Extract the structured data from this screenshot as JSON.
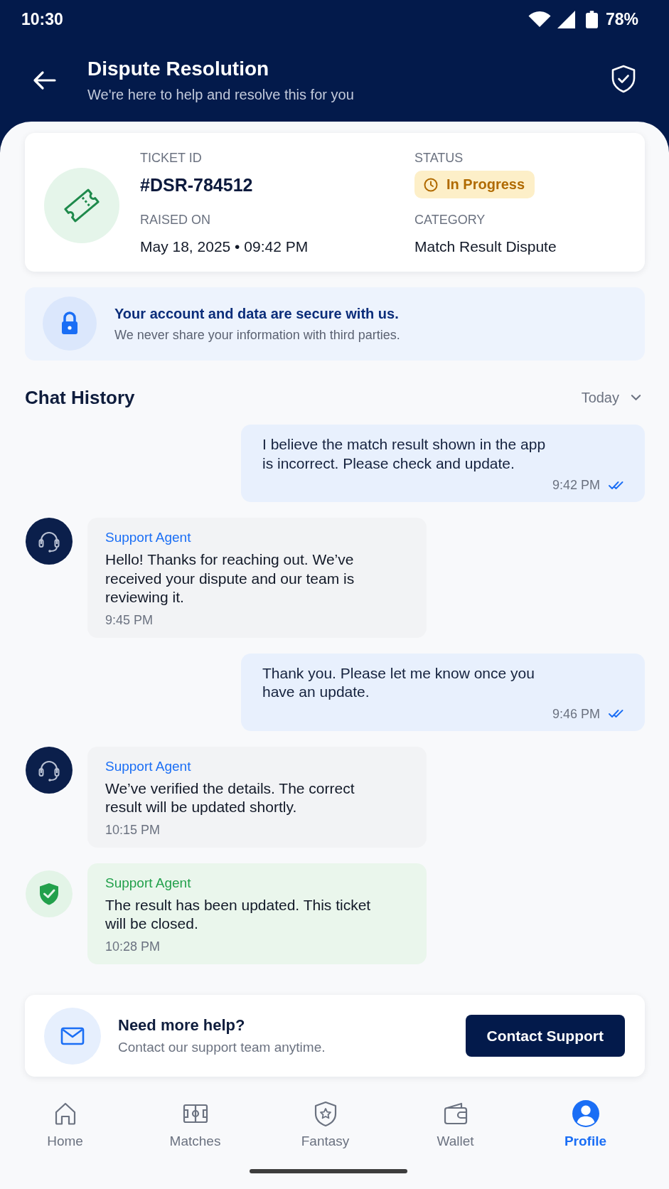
{
  "status_bar": {
    "time": "10:30",
    "battery": "78%"
  },
  "header": {
    "title": "Dispute Resolution",
    "subtitle": "We're here to help and resolve this for you"
  },
  "ticket": {
    "fields": [
      {
        "kind": "id",
        "label": "TICKET ID",
        "value": "#DSR-784512"
      },
      {
        "kind": "status",
        "label": "STATUS",
        "value": "In Progress"
      },
      {
        "kind": "text",
        "label": "RAISED ON",
        "value": "May 18, 2025 • 09:42 PM"
      },
      {
        "kind": "text",
        "label": "CATEGORY",
        "value": "Match Result Dispute"
      }
    ]
  },
  "security_notice": {
    "title": "Your account and data are secure with us.",
    "text": "We never share your information with third parties."
  },
  "chat": {
    "title": "Chat History",
    "filter": "Today",
    "messages": [
      {
        "kind": "user",
        "text": "I believe the match result shown in the app is incorrect. Please check and update.",
        "time": "9:42 PM",
        "read": true
      },
      {
        "kind": "agent",
        "sender": "Support Agent",
        "text": "Hello! Thanks for reaching out. We’ve received your dispute and our team is reviewing it.",
        "time": "9:45 PM"
      },
      {
        "kind": "user",
        "text": "Thank you. Please let me know once you have an update.",
        "time": "9:46 PM",
        "read": true
      },
      {
        "kind": "agent",
        "sender": "Support Agent",
        "text": "We’ve verified the details. The correct result will be updated shortly.",
        "time": "10:15 PM"
      },
      {
        "kind": "resolution",
        "sender": "Support Agent",
        "text": "The result has been updated. This ticket will be closed.",
        "time": "10:28 PM"
      }
    ]
  },
  "help": {
    "title": "Need more help?",
    "text": "Contact our support team anytime.",
    "button": "Contact Support"
  },
  "nav": {
    "items": [
      {
        "label": "Home",
        "selected": false
      },
      {
        "label": "Matches",
        "selected": false
      },
      {
        "label": "Fantasy",
        "selected": false
      },
      {
        "label": "Wallet",
        "selected": false
      },
      {
        "label": "Profile",
        "selected": true
      }
    ]
  }
}
